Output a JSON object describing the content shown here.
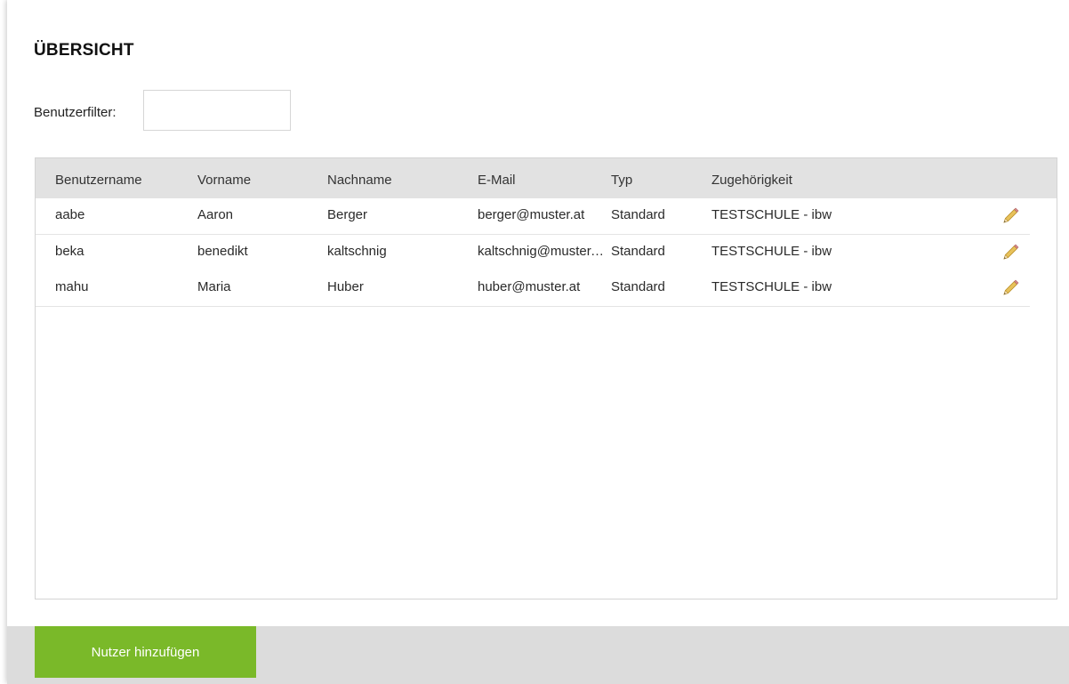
{
  "page": {
    "title": "ÜBERSICHT"
  },
  "filter": {
    "label": "Benutzerfilter:",
    "value": "",
    "placeholder": ""
  },
  "table": {
    "columns": [
      "Benutzername",
      "Vorname",
      "Nachname",
      "E-Mail",
      "Typ",
      "Zugehörigkeit"
    ],
    "rows": [
      [
        "aabe",
        "Aaron",
        "Berger",
        "berger@muster.at",
        "Standard",
        "TESTSCHULE - ibw"
      ],
      [
        "beka",
        "benedikt",
        "kaltschnig",
        "kaltschnig@muster.at",
        "Standard",
        "TESTSCHULE - ibw"
      ],
      [
        "mahu",
        "Maria",
        "Huber",
        "huber@muster.at",
        "Standard",
        "TESTSCHULE - ibw"
      ]
    ],
    "row_action_icon": "pencil-icon"
  },
  "footer": {
    "add_button_label": "Nutzer hinzufügen"
  },
  "colors": {
    "accent_green": "#7ab929",
    "header_gray": "#e2e2e2",
    "footer_gray": "#dcdcdc"
  }
}
